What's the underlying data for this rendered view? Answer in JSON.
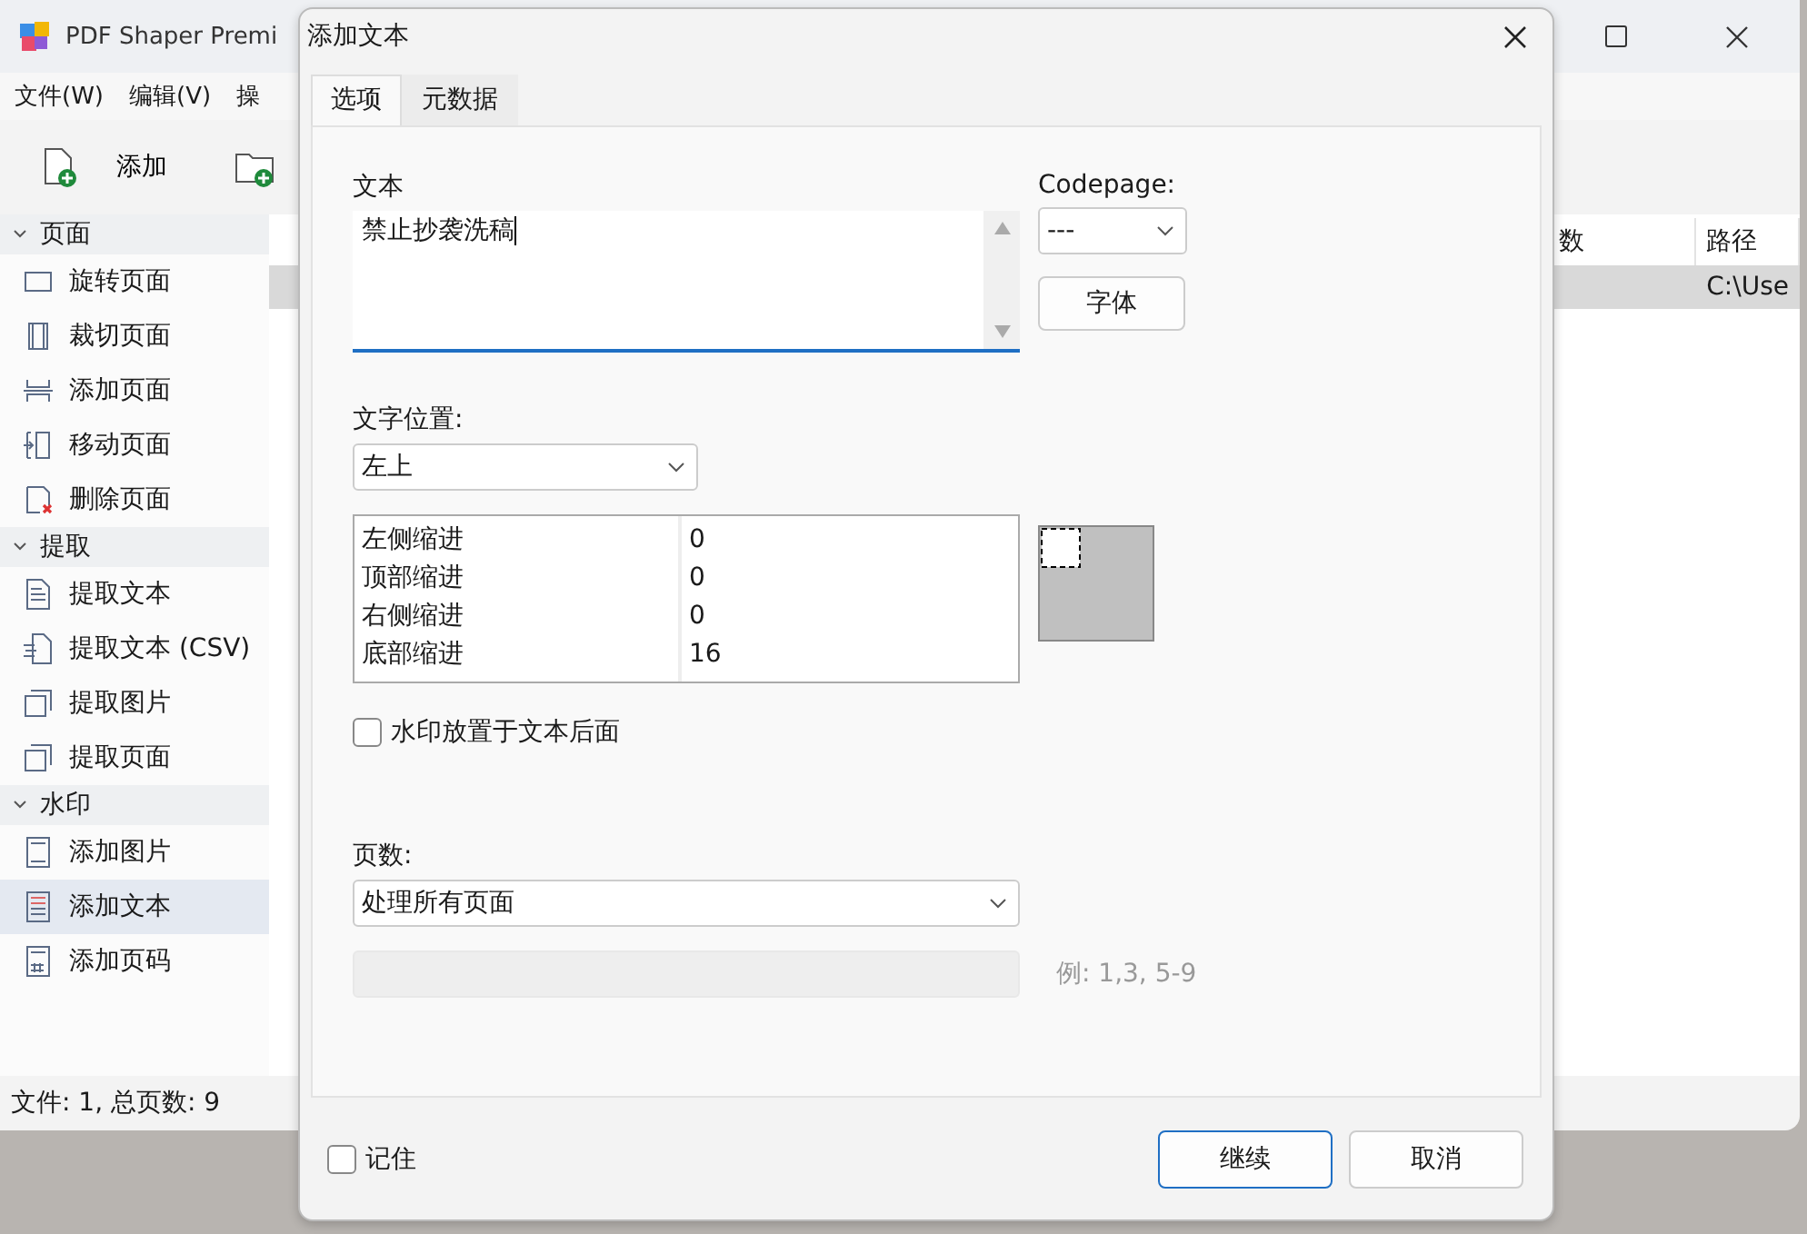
{
  "app": {
    "title": "PDF Shaper Premi",
    "menu": [
      "文件(W)",
      "编辑(V)",
      "操"
    ],
    "toolbar": [
      {
        "kind": "add-file",
        "label": "添加"
      },
      {
        "kind": "add-folder"
      }
    ],
    "sidebar": {
      "groups": [
        {
          "label": "页面",
          "expanded": true,
          "items": [
            {
              "kind": "rotate",
              "label": "旋转页面",
              "selected": false
            },
            {
              "kind": "crop",
              "label": "裁切页面",
              "selected": false
            },
            {
              "kind": "insert",
              "label": "添加页面",
              "selected": false
            },
            {
              "kind": "move",
              "label": "移动页面",
              "selected": false
            },
            {
              "kind": "delete",
              "label": "删除页面",
              "selected": false
            }
          ]
        },
        {
          "label": "提取",
          "expanded": true,
          "items": [
            {
              "kind": "text",
              "label": "提取文本",
              "selected": false
            },
            {
              "kind": "csv",
              "label": "提取文本 (CSV)",
              "selected": false
            },
            {
              "kind": "image",
              "label": "提取图片",
              "selected": false
            },
            {
              "kind": "pages",
              "label": "提取页面",
              "selected": false
            }
          ]
        },
        {
          "label": "水印",
          "expanded": true,
          "items": [
            {
              "kind": "wm-image",
              "label": "添加图片",
              "selected": false
            },
            {
              "kind": "wm-text",
              "label": "添加文本",
              "selected": true
            },
            {
              "kind": "wm-number",
              "label": "添加页码",
              "selected": false
            }
          ]
        }
      ]
    },
    "table": {
      "columns": [
        "数",
        "路径"
      ],
      "rows": [
        {
          "cells": [
            "",
            "C:\\Use"
          ],
          "selected": true
        }
      ]
    },
    "status_bar": "文件: 1, 总页数: 9"
  },
  "dialog": {
    "title": "添加文本",
    "tabs": [
      {
        "label": "选项",
        "selected": true
      },
      {
        "label": "元数据",
        "selected": false
      }
    ],
    "text_label": "文本",
    "text_value": "禁止抄袭洗稿",
    "codepage_label": "Codepage:",
    "codepage_value": "---",
    "font_button": "字体",
    "position_label": "文字位置:",
    "position_value": "左上",
    "indents": [
      {
        "label": "左侧缩进",
        "value": "0"
      },
      {
        "label": "顶部缩进",
        "value": "0"
      },
      {
        "label": "右侧缩进",
        "value": "0"
      },
      {
        "label": "底部缩进",
        "value": "16"
      }
    ],
    "behind": {
      "label": "水印放置于文本后面",
      "checked": false
    },
    "pages_label": "页数:",
    "pages_value": "处理所有页面",
    "range": {
      "disabled": true,
      "example": "例: 1,3, 5-9"
    },
    "remember": {
      "label": "记住",
      "checked": false
    },
    "buttons": [
      {
        "label": "继续",
        "default": true
      },
      {
        "label": "取消",
        "default": false
      }
    ]
  }
}
